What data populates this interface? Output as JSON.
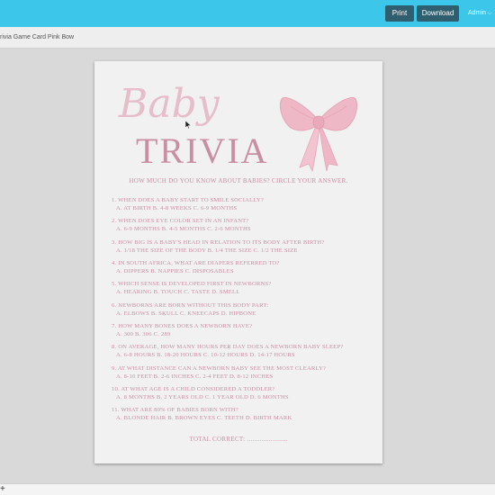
{
  "toolbar": {
    "print_label": "Print",
    "download_label": "Download",
    "user_label": "Admin"
  },
  "document": {
    "title": "rivia Game Card Pink Bow"
  },
  "card": {
    "heading_script": "Baby",
    "heading_main": "TRIVIA",
    "subtitle": "HOW MUCH DO YOU KNOW ABOUT BABIES? CIRCLE YOUR ANSWER.",
    "questions": [
      {
        "text": "1. WHEN DOES A BABY START TO SMILE SOCIALLY?",
        "options": "A. AT BIRTH    B. 4-8 WEEKS    C. 6-9 MONTHS"
      },
      {
        "text": "2. WHEN DOES EYE COLOR SET IN AN INFANT?",
        "options": "A. 6-9 MONTHS    B. 4-5 MONTHS    C. 2-6 MONTHS"
      },
      {
        "text": "3. HOW BIG IS A BABY'S HEAD IN RELATION TO ITS BODY AFTER BIRTH?",
        "options": "A. 1/18 THE SIZE OF THE BODY    B. 1/4 THE SIZE    C. 1/2 THE SIZE"
      },
      {
        "text": "4. IN SOUTH AFRICA, WHAT ARE DIAPERS REFERRED TO?",
        "options": "A. DIPPERS    B. NAPPIES    C. DISPOSABLES"
      },
      {
        "text": "5. WHICH SENSE IS DEVELOPED FIRST IN NEWBORNS?",
        "options": "A. HEARING    B. TOUCH    C. TASTE    D. SMELL"
      },
      {
        "text": "6. NEWBORNS ARE BORN WITHOUT THIS BODY PART:",
        "options": "A. ELBOWS    B. SKULL    C. KNEECAPS    D. HIPBONE"
      },
      {
        "text": "7. HOW MANY BONES DOES A NEWBORN HAVE?",
        "options": "A. 300    B. 306    C. 289"
      },
      {
        "text": "8. ON AVERAGE, HOW MANY HOURS PER DAY DOES A NEWBORN BABY SLEEP?",
        "options": "A. 6-8 HOURS    B. 18-20 HOURS    C. 10-12 HOURS    D. 14-17 HOURS"
      },
      {
        "text": "9. AT WHAT DISTANCE CAN A NEWBORN BABY SEE THE MOST CLEARLY?",
        "options": "A. 8-10 FEET    B. 2-6 INCHES    C. 2-4 FEET    D. 8-12 INCHES"
      },
      {
        "text": "10. AT WHAT AGE IS A CHILD CONSIDERED A TODDLER?",
        "options": "A. 8 MONTHS    B. 2 YEARS OLD    C. 1 YEAR OLD    D. 6 MONTHS"
      },
      {
        "text": "11. WHAT ARE 80% OF BABIES BORN WITH?",
        "options": "A. BLONDE HAIR    B. BROWN EYES    C. TEETH    D. BIRTH MARK"
      }
    ],
    "total_label": "TOTAL CORRECT: ......................"
  },
  "colors": {
    "topbar": "#3bc6ea",
    "button": "#2f5e6e",
    "accent_pink": "#c98ea1",
    "script_pink": "#e6bdc9",
    "bow_pink": "#efb8c6"
  },
  "icons": {
    "user_menu": "chevron-down-icon",
    "bow": "pink-bow-icon",
    "cursor": "pointer-icon",
    "zoom": "plus-icon"
  },
  "zoom": {
    "plus_label": "+"
  }
}
